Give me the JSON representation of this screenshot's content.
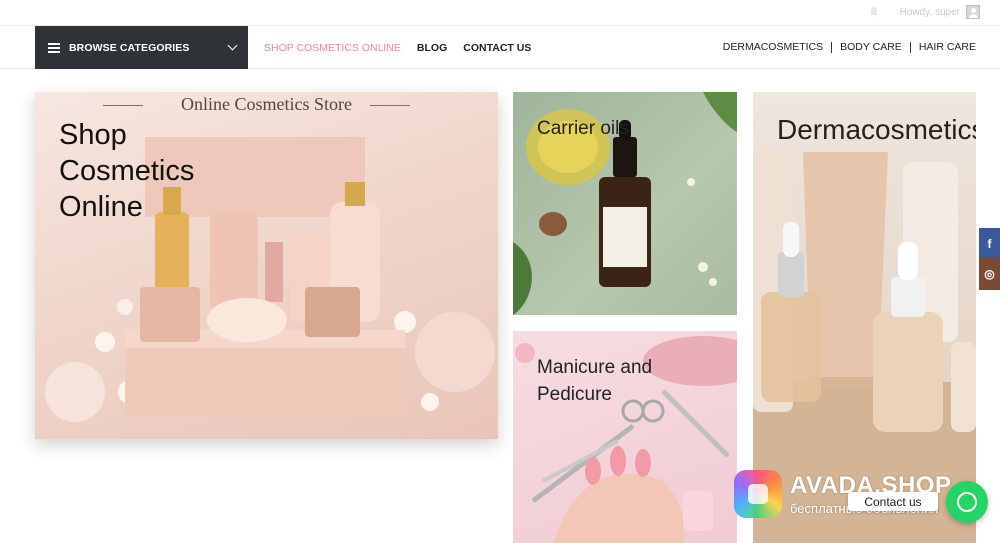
{
  "topbar": {
    "greeting": "Howdy, super"
  },
  "navbar": {
    "browse_label": "BROWSE CATEGORIES",
    "left_links": [
      "SHOP COSMETICS ONLINE",
      "BLOG",
      "CONTACT US"
    ],
    "right_links": [
      "DERMACOSMETICS",
      "BODY CARE",
      "HAIR CARE"
    ]
  },
  "tiles": {
    "hero": {
      "banner": "Online Cosmetics Store",
      "title": "Shop\nCosmetics\nOnline"
    },
    "carrier": {
      "title": "Carrier oils"
    },
    "manicure": {
      "title": "Manicure and\nPedicure"
    },
    "derma": {
      "title": "Dermacosmetics"
    }
  },
  "social": {
    "facebook": "f",
    "instagram": "◎"
  },
  "overlay": {
    "watermark_title": "AVADA.SHOP",
    "watermark_sub": "бесплатные объявления",
    "contact_label": "Contact us"
  },
  "colors": {
    "nav_dark": "#2f3337",
    "accent_pink": "#e38a9a",
    "facebook": "#3b5998",
    "whatsapp": "#25d366"
  }
}
